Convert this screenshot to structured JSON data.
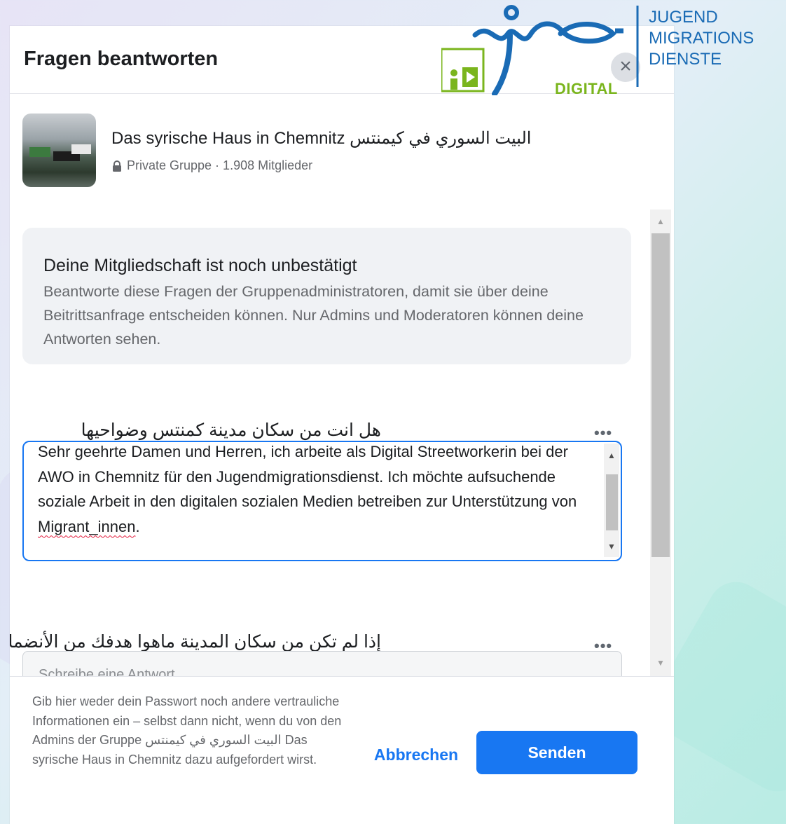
{
  "dialog": {
    "title": "Fragen beantworten",
    "close_label": "×"
  },
  "group": {
    "name": "Das syrische Haus in Chemnitz البيت السوري في كيمنتس",
    "meta": "Private Gruppe · 1.908 Mitglieder"
  },
  "info": {
    "title": "Deine Mitgliedschaft ist noch unbestätigt",
    "body": "Beantworte diese Fragen der Gruppenadministratoren, damit sie über deine Beitrittsanfrage entscheiden können. Nur Admins und Moderatoren können deine Antworten sehen."
  },
  "questions": [
    {
      "text": "هل انت من سكان مدينة كمنتس وضواحيها",
      "more": "•••",
      "answer_before": "Sehr geehrte Damen und Herren, ich arbeite als Digital Streetworkerin bei der AWO in Chemnitz für den Jugendmigrationsdienst. Ich möchte aufsuchende soziale Arbeit in den digitalen sozialen Medien betreiben zur Unterstützung von ",
      "answer_misspelled": "Migrant_innen",
      "answer_after": "."
    },
    {
      "text": "إذا لم تكن من سكان المدينة ماهوا هدفك من الأنضمام ؟",
      "more": "•••",
      "placeholder": "Schreibe eine Antwort..."
    }
  ],
  "footer": {
    "note": "Gib hier weder dein Passwort noch andere vertrauliche Informationen ein – selbst dann nicht, wenn du von den Admins der Gruppe البيت السوري في كيمنتس Das syrische Haus in Chemnitz dazu aufgefordert wirst.",
    "cancel_label": "Abbrechen",
    "send_label": "Senden"
  },
  "logo": {
    "mark": "jmd",
    "sub": "DIGITAL",
    "line1": "JUGEND",
    "line2": "MIGRATIONS",
    "line3": "DIENSTE"
  },
  "colors": {
    "primary": "#1877f2",
    "logo_blue": "#1a6bb5",
    "logo_green": "#7ab51d"
  }
}
